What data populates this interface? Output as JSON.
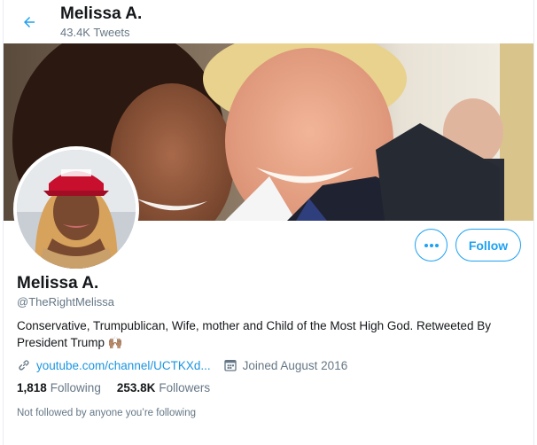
{
  "header": {
    "name": "Melissa A.",
    "tweet_count": "43.4K Tweets",
    "back_icon": "arrow-left-icon"
  },
  "profile": {
    "name": "Melissa A.",
    "handle": "@TheRightMelissa",
    "bio": "Conservative, Trumpublican, Wife, mother and Child of the Most High God. Retweeted By President Trump 🙌🏽",
    "website": "youtube.com/channel/UCTKXd...",
    "joined": "Joined August 2016"
  },
  "actions": {
    "more_icon": "more-horizontal-icon",
    "follow_label": "Follow"
  },
  "stats": {
    "following_count": "1,818",
    "following_label": "Following",
    "followers_count": "253.8K",
    "followers_label": "Followers"
  },
  "footnote": "Not followed by anyone you’re following",
  "colors": {
    "accent": "#1da1f2",
    "link": "#1b95e0",
    "secondary_text": "#657786",
    "primary_text": "#14171a"
  }
}
